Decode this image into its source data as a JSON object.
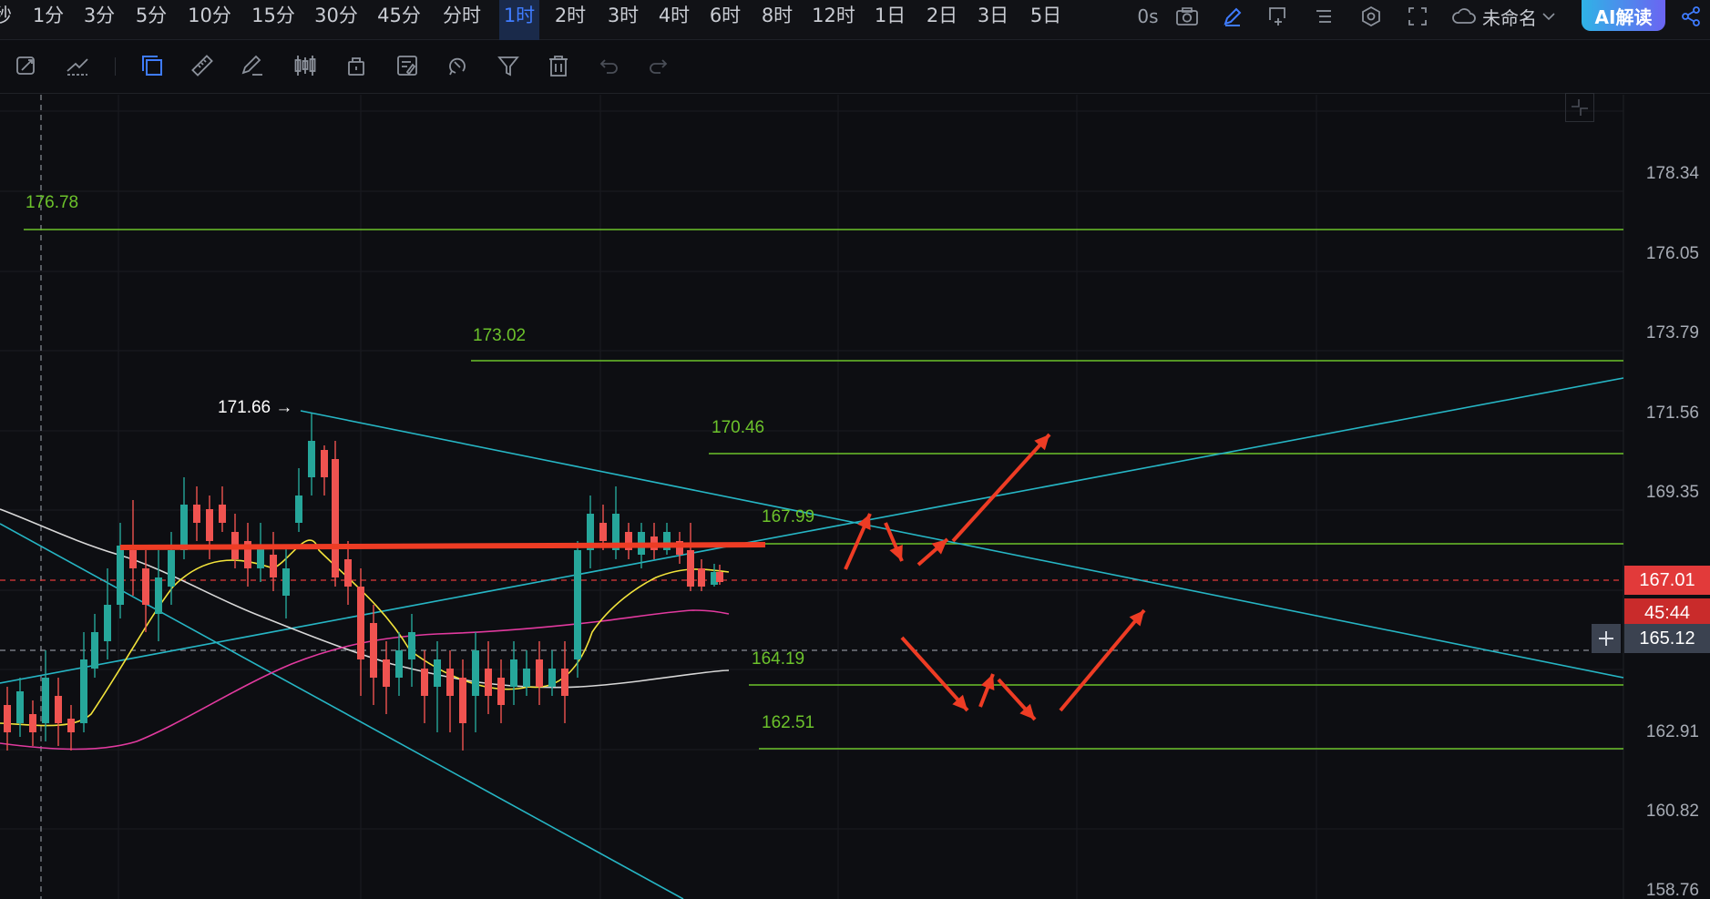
{
  "timeframes": [
    "秒",
    "1分",
    "3分",
    "5分",
    "10分",
    "15分",
    "30分",
    "45分",
    "分时",
    "1时",
    "2时",
    "3时",
    "4时",
    "6时",
    "8时",
    "12时",
    "1日",
    "2日",
    "3日",
    "5日"
  ],
  "active_timeframe": "1时",
  "topbar": {
    "latency": "0s",
    "layout_name": "未命名",
    "ai_button": "AI解读",
    "icons": [
      "camera-icon",
      "pencil-icon",
      "add-window-icon",
      "list-icon",
      "settings-icon",
      "fullscreen-icon",
      "cloud-icon",
      "share-icon"
    ]
  },
  "toolbar": {
    "icons": [
      "sync-draw-icon",
      "trend-line-icon",
      "select-rect-icon",
      "ruler-icon",
      "brush-icon",
      "candles-icon",
      "lock-icon",
      "note-icon",
      "magnet-icon",
      "filter-icon",
      "trash-icon",
      "undo-icon",
      "redo-icon"
    ]
  },
  "chart": {
    "price_axis": [
      "178.34",
      "176.05",
      "173.79",
      "171.56",
      "169.35",
      "167.01",
      "162.91",
      "160.82",
      "158.76"
    ],
    "levels": [
      "176.78",
      "173.02",
      "170.46",
      "167.99",
      "164.19",
      "162.51"
    ],
    "peak_label": "171.66",
    "current_price": "167.01",
    "countdown": "45:44",
    "crosshair_price": "165.12",
    "colors": {
      "up": "#26a69a",
      "down": "#ef5350",
      "level": "#6cc22b",
      "trend": "#26b5c4",
      "annotation": "#ee3c24",
      "ma_fast": "#f2e33b",
      "ma_mid": "#e23a9f",
      "ma_slow": "#d8d8d8"
    }
  }
}
